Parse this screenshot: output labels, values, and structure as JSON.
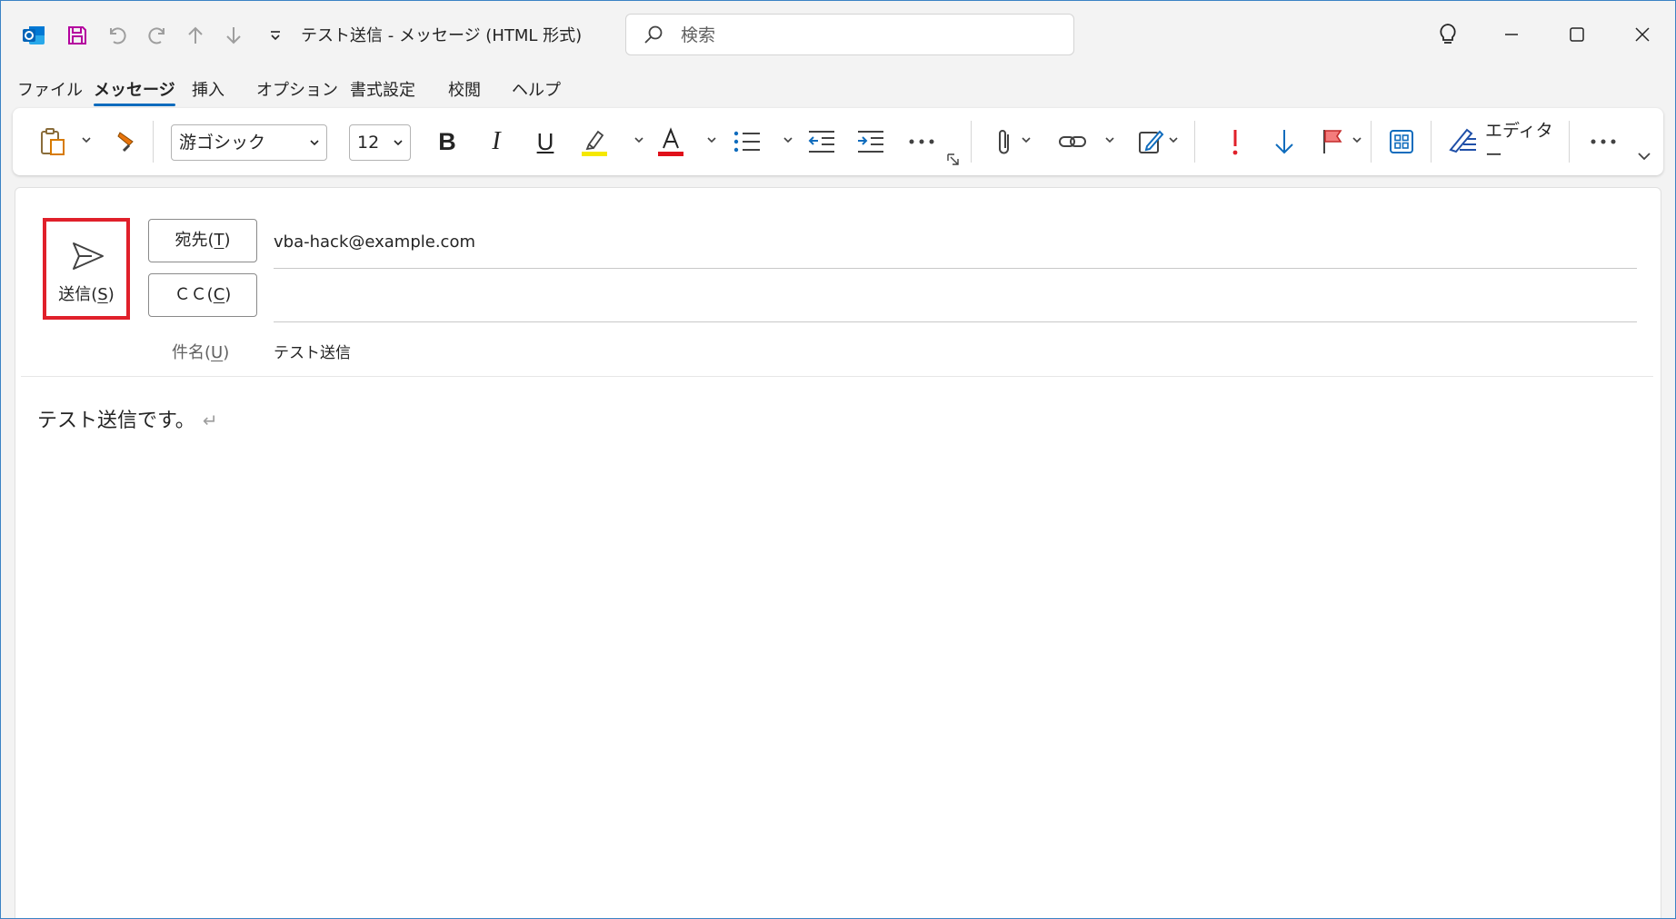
{
  "window": {
    "title": "テスト送信  -  メッセージ (HTML 形式)"
  },
  "search": {
    "placeholder": "検索"
  },
  "menu": {
    "tabs": [
      {
        "label": "ファイル"
      },
      {
        "label": "メッセージ"
      },
      {
        "label": "挿入"
      },
      {
        "label": "オプション"
      },
      {
        "label": "書式設定"
      },
      {
        "label": "校閲"
      },
      {
        "label": "ヘルプ"
      }
    ],
    "active_index": 1
  },
  "ribbon": {
    "font_name": "游ゴシック",
    "font_size": "12",
    "editor_label": "エディター",
    "colors": {
      "highlight": "#f5e800",
      "font_color": "#e0101a",
      "accent": "#0f6cbd",
      "importance": "#e0202a"
    }
  },
  "compose": {
    "send": {
      "label": "送信",
      "accel": "S"
    },
    "to": {
      "label": "宛先",
      "accel": "T",
      "value": "vba-hack@example.com"
    },
    "cc": {
      "label": "ＣＣ",
      "accel": "C",
      "value": ""
    },
    "subject": {
      "label": "件名",
      "accel": "U",
      "value": "テスト送信"
    },
    "body": "テスト送信です。",
    "paragraph_mark": "↵"
  }
}
